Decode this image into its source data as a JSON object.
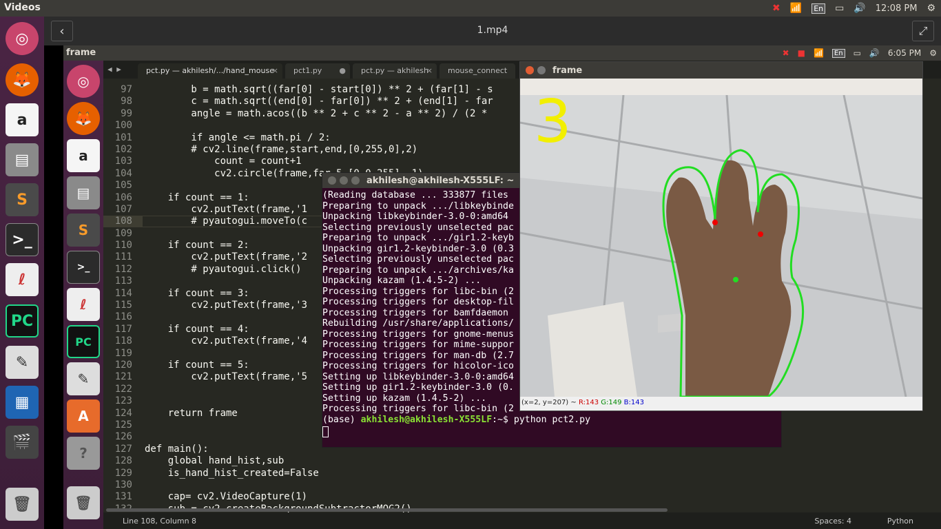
{
  "topbar": {
    "app_title": "Videos",
    "lang": "En",
    "time": "12:08 PM"
  },
  "video_header": {
    "title": "1.mp4"
  },
  "inner_topbar": {
    "title": "frame",
    "lang": "En",
    "time": "6:05 PM"
  },
  "editor": {
    "tabs": [
      {
        "label": "pct.py — akhilesh/.../hand_mouse",
        "close": "×"
      },
      {
        "label": "pct1.py",
        "close": "●"
      },
      {
        "label": "pct.py — akhilesh",
        "close": "×"
      },
      {
        "label": "mouse_connect",
        "close": ""
      }
    ],
    "line_numbers": [
      "97",
      "98",
      "99",
      "100",
      "101",
      "102",
      "103",
      "104",
      "105",
      "106",
      "107",
      "108",
      "109",
      "110",
      "111",
      "112",
      "113",
      "114",
      "115",
      "116",
      "117",
      "118",
      "119",
      "120",
      "121",
      "122",
      "123",
      "124",
      "125",
      "126",
      "127",
      "128",
      "129",
      "130",
      "131",
      "132"
    ],
    "code_lines": [
      "        b = math.sqrt((far[0] - start[0]) ** 2 + (far[1] - s",
      "        c = math.sqrt((end[0] - far[0]) ** 2 + (end[1] - far",
      "        angle = math.acos((b ** 2 + c ** 2 - a ** 2) / (2 *",
      "",
      "        if angle <= math.pi / 2:",
      "        # cv2.line(frame,start,end,[0,255,0],2)",
      "            count = count+1",
      "            cv2.circle(frame,far,5,[0,0,255],-1)",
      "",
      "    if count == 1:",
      "        cv2.putText(frame,'1",
      "        # pyautogui.moveTo(c",
      "",
      "    if count == 2:",
      "        cv2.putText(frame,'2",
      "        # pyautogui.click()",
      "",
      "    if count == 3:",
      "        cv2.putText(frame,'3",
      "",
      "    if count == 4:",
      "        cv2.putText(frame,'4",
      "",
      "    if count == 5:",
      "        cv2.putText(frame,'5",
      "",
      "",
      "    return frame",
      "",
      "",
      "def main():",
      "    global hand_hist,sub",
      "    is_hand_hist_created=False",
      "",
      "    cap= cv2.VideoCapture(1)",
      "    sub = cv2.createBackgroundSubtractorMOG2()"
    ],
    "status_position": "Line 108, Column 8",
    "status_spaces": "Spaces: 4",
    "status_language": "Python"
  },
  "terminal": {
    "title": "akhilesh@akhilesh-X555LF: ~",
    "lines": [
      "(Reading database ... 333877 files",
      "Preparing to unpack .../libkeybinde",
      "Unpacking libkeybinder-3.0-0:amd64",
      "Selecting previously unselected pac",
      "Preparing to unpack .../gir1.2-keyb",
      "Unpacking gir1.2-keybinder-3.0 (0.3",
      "Selecting previously unselected pac",
      "Preparing to unpack .../archives/ka",
      "Unpacking kazam (1.4.5-2) ...",
      "Processing triggers for libc-bin (2",
      "Processing triggers for desktop-fil",
      "Processing triggers for bamfdaemon",
      "Rebuilding /usr/share/applications/",
      "Processing triggers for gnome-menus",
      "Processing triggers for mime-suppor",
      "Processing triggers for man-db (2.7",
      "Processing triggers for hicolor-ico",
      "Setting up libkeybinder-3.0-0:amd64",
      "Setting up gir1.2-keybinder-3.0 (0.",
      "Setting up kazam (1.4.5-2) ...",
      "Processing triggers for libc-bin (2"
    ],
    "prompt_env": "(base) ",
    "prompt_user": "akhilesh@akhilesh-X555LF",
    "prompt_path": ":~$ ",
    "prompt_command": "python pct2.py"
  },
  "frame_window": {
    "title": "frame",
    "count_digit": "3",
    "info_coords": "(x=2, y=207) ~ ",
    "info_r": "R:143",
    "info_g": "G:149",
    "info_b": "B:143"
  }
}
